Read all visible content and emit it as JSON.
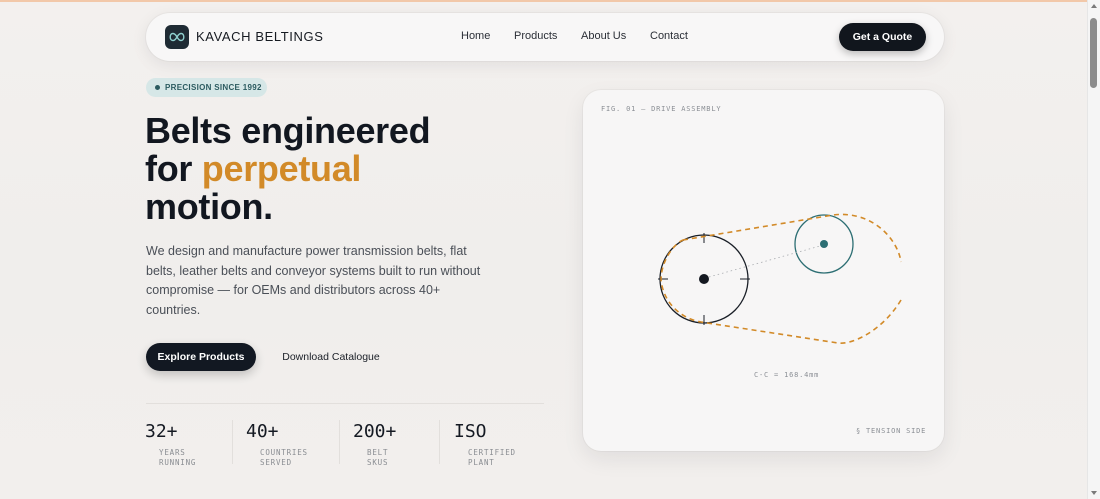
{
  "brand": {
    "name": "KAVACH BELTINGS"
  },
  "nav": {
    "links": [
      "Home",
      "Products",
      "About Us",
      "Contact"
    ],
    "cta": "Get a Quote"
  },
  "hero": {
    "badge": "PRECISION SINCE 1992",
    "headline_line1": "Belts engineered",
    "headline_line2_a": "for ",
    "headline_line2_b": "perpetual",
    "headline_line3": "motion.",
    "subtitle": "We design and manufacture power transmission belts, flat belts, leather belts and conveyor systems built to run without compromise — for OEMs and distributors across 40+ countries.",
    "primary_button": "Explore Products",
    "secondary_button": "Download Catalogue"
  },
  "stats": [
    {
      "value": "32+",
      "label_line1": "YEARS",
      "label_line2": "RUNNING"
    },
    {
      "value": "40+",
      "label_line1": "COUNTRIES",
      "label_line2": "SERVED"
    },
    {
      "value": "200+",
      "label_line1": "BELT",
      "label_line2": "SKUS"
    },
    {
      "value": "ISO",
      "label_line1": "CERTIFIED",
      "label_line2": "PLANT"
    }
  ],
  "figure": {
    "title": "FIG. 01 — DRIVE ASSEMBLY",
    "center_distance": "C-C = 168.4mm",
    "tension_label": "§ TENSION SIDE"
  },
  "colors": {
    "accent": "#d28a28",
    "dark": "#121822",
    "teal": "#2c6e73",
    "badge_bg": "#d6e7e7"
  },
  "icons": {
    "logo": "infinity-icon"
  }
}
